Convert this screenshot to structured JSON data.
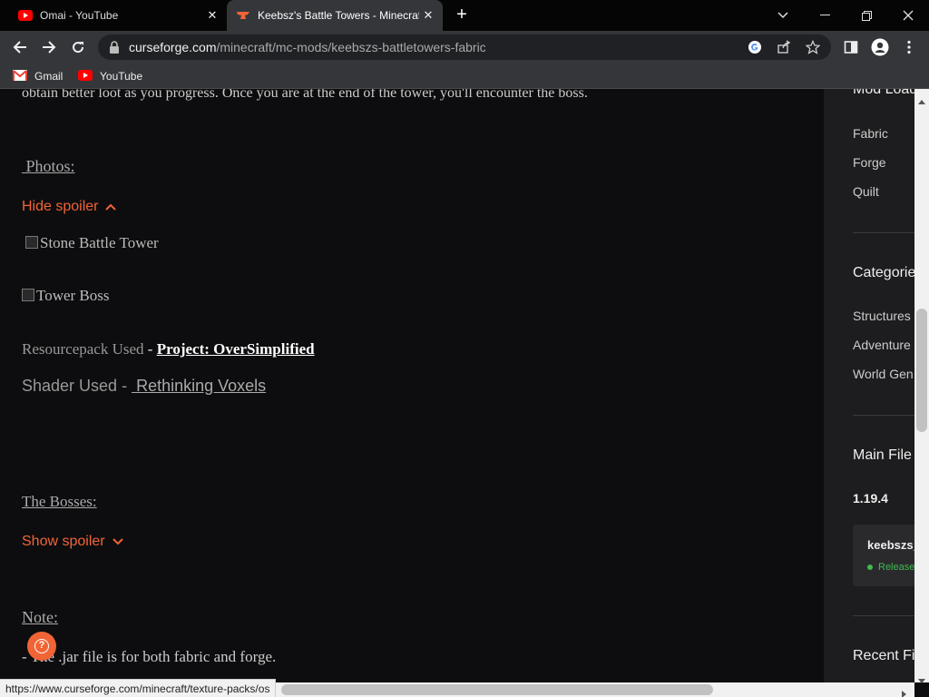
{
  "browser": {
    "tabs": [
      {
        "title": "Omai - YouTube",
        "favicon": "youtube-icon"
      },
      {
        "title": "Keebsz's Battle Towers - Minecraft",
        "favicon": "curseforge-icon"
      }
    ],
    "url": {
      "host": "curseforge.com",
      "path": "/minecraft/mc-mods/keebszs-battletowers-fabric"
    },
    "bookmarks": [
      {
        "label": "Gmail",
        "icon": "gmail-icon"
      },
      {
        "label": "YouTube",
        "icon": "youtube-icon"
      }
    ],
    "status_url": "https://www.curseforge.com/minecraft/texture-packs/os"
  },
  "article": {
    "intro_partial": "obtain better loot as you progress. Once you are at the end of the tower, you'll encounter the boss.",
    "photos_heading": " Photos:",
    "hide_spoiler": "Hide spoiler",
    "image_alt_1": "Stone Battle Tower",
    "image_alt_2": "Tower Boss",
    "resourcepack_label": "Resourcepack Used",
    "resourcepack_sep": " - ",
    "resourcepack_link": "Project: OverSimplified",
    "shader_label": "Shader Used - ",
    "shader_link": " Rethinking Voxels",
    "bosses_heading": "The Bosses:",
    "show_spoiler": "Show spoiler",
    "note_heading": "Note:",
    "note_line": "- The .jar file is for both fabric and forge."
  },
  "sidebar": {
    "modloaders_heading": "Mod Loaders",
    "modloaders": [
      "Fabric",
      "Forge",
      "Quilt"
    ],
    "categories_heading": "Categories",
    "categories": [
      "Structures",
      "Adventure",
      "World Gen"
    ],
    "main_file_heading": "Main File",
    "version": "1.19.4",
    "file_name": "keebszs_",
    "release_label": "Release",
    "recent_heading": "Recent Files"
  },
  "colors": {
    "accent": "#f16436",
    "release": "#3fb950"
  }
}
